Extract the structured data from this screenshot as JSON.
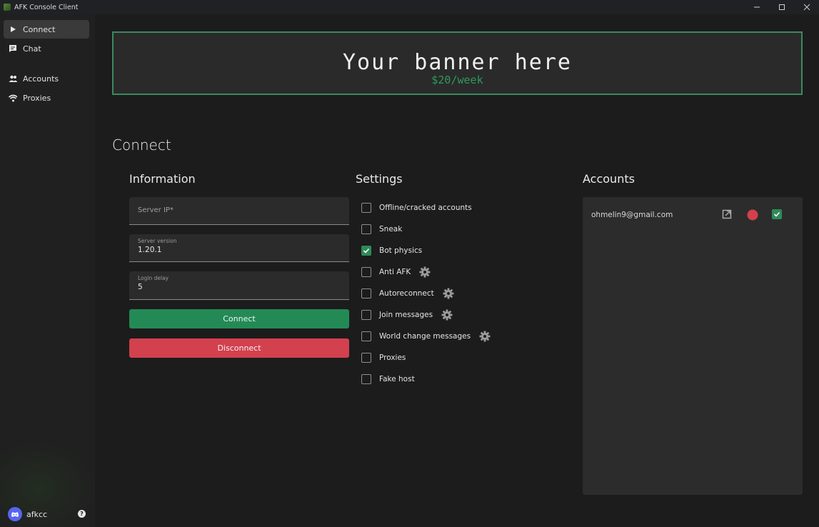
{
  "window": {
    "title": "AFK Console Client",
    "controls": {
      "minimize": "minimize-icon",
      "maximize": "maximize-icon",
      "close": "close-icon"
    }
  },
  "sidebar": {
    "items": [
      {
        "label": "Connect",
        "icon": "play-icon",
        "active": true
      },
      {
        "label": "Chat",
        "icon": "chat-icon",
        "active": false
      },
      {
        "label": "Accounts",
        "icon": "people-icon",
        "active": false
      },
      {
        "label": "Proxies",
        "icon": "wifi-icon",
        "active": false
      }
    ],
    "user": {
      "name": "afkcc",
      "icon": "discord-icon"
    },
    "help_icon": "help-icon"
  },
  "banner": {
    "title": "Your banner here",
    "subtitle": "$20/week",
    "border_color": "#3b8a5e"
  },
  "page": {
    "title": "Connect"
  },
  "information": {
    "title": "Information",
    "server_ip": {
      "placeholder": "Server IP*",
      "value": ""
    },
    "server_version": {
      "label": "Server version",
      "value": "1.20.1"
    },
    "login_delay": {
      "label": "Login delay",
      "value": "5"
    },
    "connect_label": "Connect",
    "disconnect_label": "Disconnect",
    "connect_color": "#238a56",
    "disconnect_color": "#d3404e"
  },
  "settings": {
    "title": "Settings",
    "options": [
      {
        "label": "Offline/cracked accounts",
        "checked": false,
        "gear": false
      },
      {
        "label": "Sneak",
        "checked": false,
        "gear": false
      },
      {
        "label": "Bot physics",
        "checked": true,
        "gear": false
      },
      {
        "label": "Anti AFK",
        "checked": false,
        "gear": true
      },
      {
        "label": "Autoreconnect",
        "checked": false,
        "gear": true
      },
      {
        "label": "Join messages",
        "checked": false,
        "gear": true
      },
      {
        "label": "World change messages",
        "checked": false,
        "gear": true
      },
      {
        "label": "Proxies",
        "checked": false,
        "gear": false
      },
      {
        "label": "Fake host",
        "checked": false,
        "gear": false
      }
    ]
  },
  "accounts": {
    "title": "Accounts",
    "list": [
      {
        "email": "ohmelin9@gmail.com",
        "status_color": "#d3404e",
        "selected": true
      }
    ]
  }
}
